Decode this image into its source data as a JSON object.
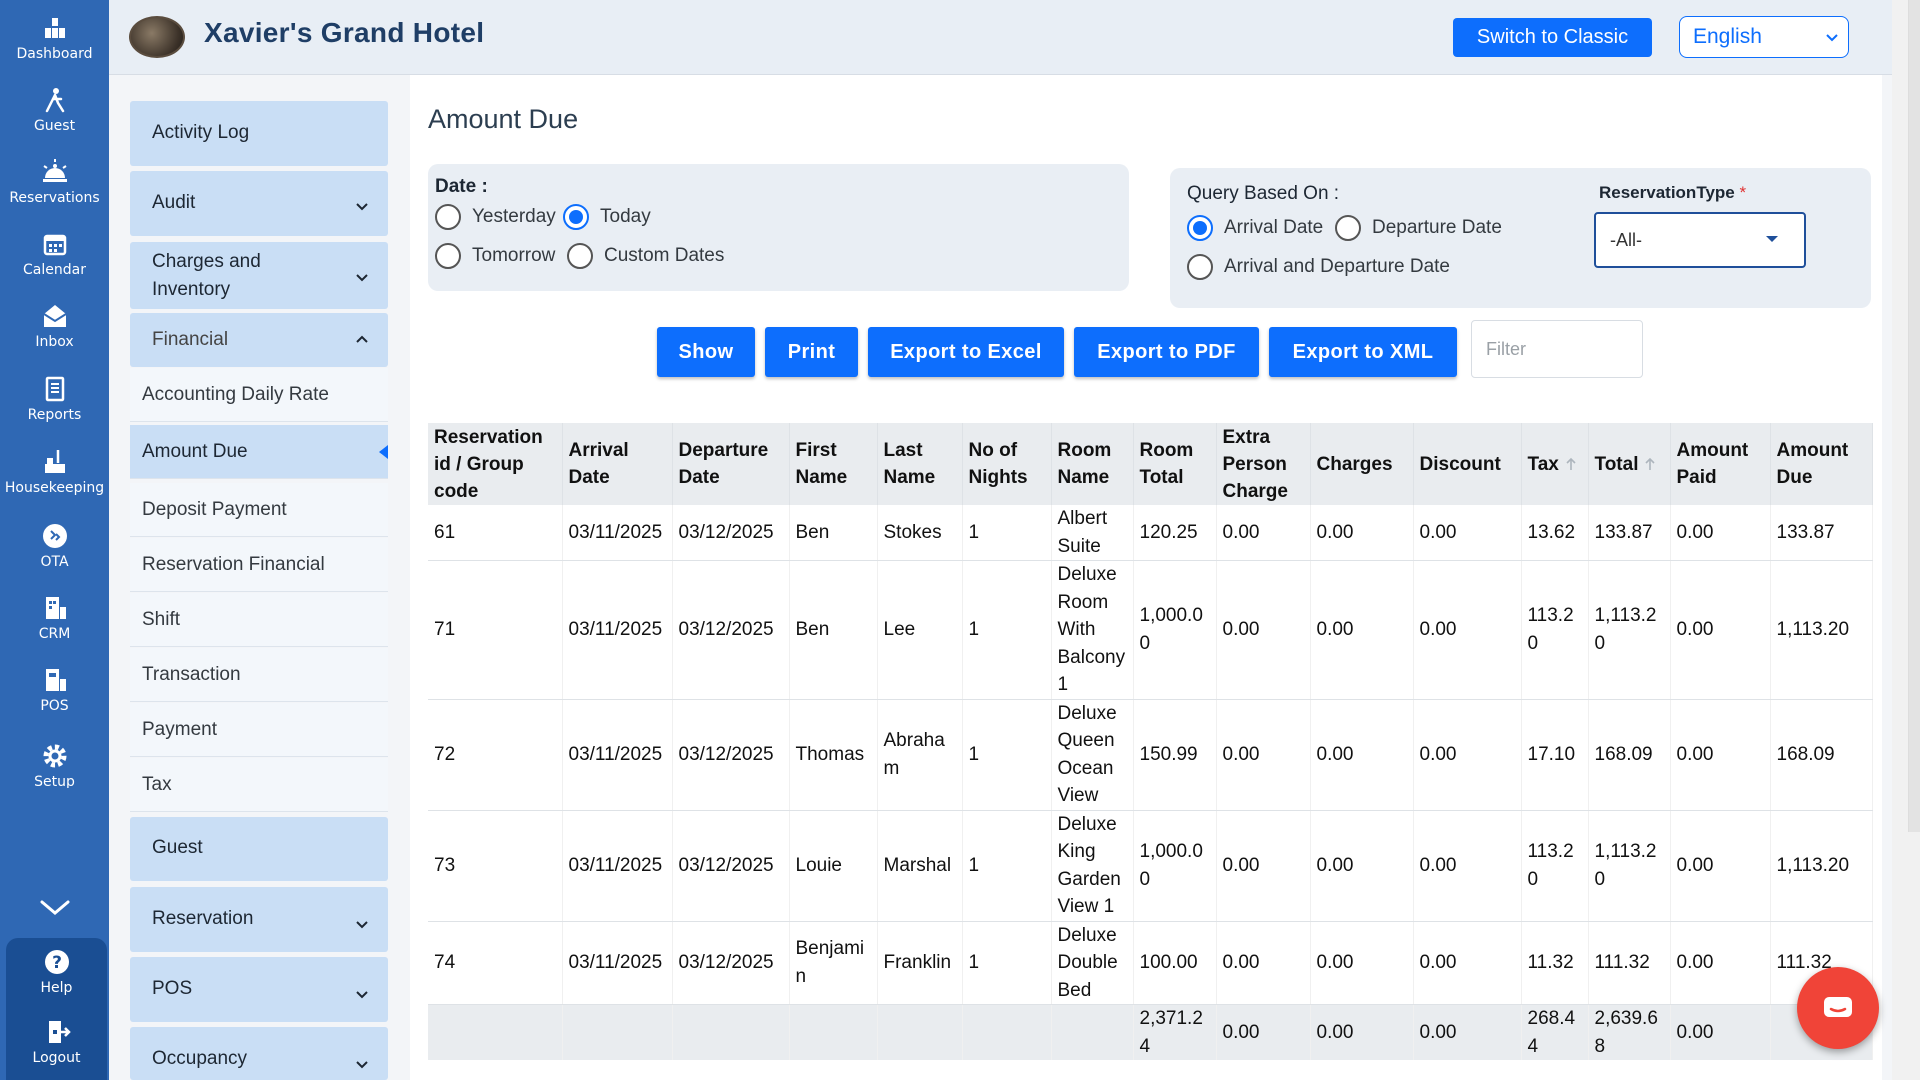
{
  "rail": {
    "items": [
      {
        "label": "Dashboard",
        "icon": "dashboard-icon"
      },
      {
        "label": "Guest",
        "icon": "guest-icon"
      },
      {
        "label": "Reservations",
        "icon": "reservations-icon"
      },
      {
        "label": "Calendar",
        "icon": "calendar-icon"
      },
      {
        "label": "Inbox",
        "icon": "inbox-icon"
      },
      {
        "label": "Reports",
        "icon": "reports-icon"
      },
      {
        "label": "Housekeeping",
        "icon": "housekeeping-icon"
      },
      {
        "label": "OTA",
        "icon": "ota-icon"
      },
      {
        "label": "CRM",
        "icon": "crm-icon"
      },
      {
        "label": "POS",
        "icon": "pos-icon"
      },
      {
        "label": "Setup",
        "icon": "setup-icon"
      }
    ],
    "help": "Help",
    "logout": "Logout"
  },
  "header": {
    "hotel_name": "Xavier's Grand Hotel",
    "switch_label": "Switch to Classic",
    "language": "English"
  },
  "sidenav": {
    "activity_log": "Activity Log",
    "audit": "Audit",
    "charges_line1": "Charges and",
    "charges_line2": "Inventory",
    "financial": "Financial",
    "financial_items": [
      "Accounting Daily Rate",
      "Amount Due",
      "Deposit Payment",
      "Reservation Financial",
      "Shift",
      "Transaction",
      "Payment",
      "Tax"
    ],
    "guest": "Guest",
    "reservation": "Reservation",
    "pos": "POS",
    "occupancy": "Occupancy"
  },
  "page": {
    "title": "Amount Due",
    "date_label": "Date :",
    "date_options": [
      "Yesterday",
      "Today",
      "Tomorrow",
      "Custom Dates"
    ],
    "date_selected": "Today",
    "query_label": "Query Based On :",
    "query_options": [
      "Arrival Date",
      "Departure Date",
      "Arrival and Departure Date"
    ],
    "query_selected": "Arrival Date",
    "restype_label": "ReservationType",
    "restype_required": "*",
    "restype_value": "-All-",
    "buttons": {
      "show": "Show",
      "print": "Print",
      "excel": "Export to Excel",
      "pdf": "Export to PDF",
      "xml": "Export to XML"
    },
    "filter_placeholder": "Filter"
  },
  "table": {
    "headers": [
      [
        "Reservation",
        "id / Group",
        "code"
      ],
      [
        "Arrival",
        "Date"
      ],
      [
        "Departure",
        "Date"
      ],
      [
        "First",
        "Name"
      ],
      [
        "Last",
        "Name"
      ],
      [
        "No of",
        "Nights"
      ],
      [
        "Room",
        "Name"
      ],
      [
        "Room",
        "Total"
      ],
      [
        "Extra",
        "Person",
        "Charge"
      ],
      [
        "Charges"
      ],
      [
        "Discount"
      ],
      [
        "Tax"
      ],
      [
        "Total"
      ],
      [
        "Amount",
        "Paid"
      ],
      [
        "Amount",
        "Due"
      ]
    ],
    "rows": [
      {
        "id": "61",
        "arrival": "03/11/2025",
        "departure": "03/12/2025",
        "first": "Ben",
        "last": "Stokes",
        "nights": "1",
        "room": [
          "Albert",
          "Suite"
        ],
        "room_total": "120.25",
        "extra": "0.00",
        "charges": "0.00",
        "discount": "0.00",
        "tax": "13.62",
        "total": "133.87",
        "paid": "0.00",
        "due": "133.87"
      },
      {
        "id": "71",
        "arrival": "03/11/2025",
        "departure": "03/12/2025",
        "first": "Ben",
        "last": "Lee",
        "nights": "1",
        "room": [
          "Deluxe",
          "Room",
          "With",
          "Balcony",
          "1"
        ],
        "room_total": "1,000.00",
        "extra": "0.00",
        "charges": "0.00",
        "discount": "0.00",
        "tax": "113.20",
        "total": "1,113.20",
        "paid": "0.00",
        "due": "1,113.20"
      },
      {
        "id": "72",
        "arrival": "03/11/2025",
        "departure": "03/12/2025",
        "first": "Thomas",
        "last": "Abraham",
        "nights": "1",
        "room": [
          "Deluxe",
          "Queen",
          "Ocean",
          "View"
        ],
        "room_total": "150.99",
        "extra": "0.00",
        "charges": "0.00",
        "discount": "0.00",
        "tax": "17.10",
        "total": "168.09",
        "paid": "0.00",
        "due": "168.09"
      },
      {
        "id": "73",
        "arrival": "03/11/2025",
        "departure": "03/12/2025",
        "first": "Louie",
        "last": "Marshal",
        "nights": "1",
        "room": [
          "Deluxe",
          "King",
          "Garden",
          "View 1"
        ],
        "room_total": "1,000.00",
        "extra": "0.00",
        "charges": "0.00",
        "discount": "0.00",
        "tax": "113.20",
        "total": "1,113.20",
        "paid": "0.00",
        "due": "1,113.20"
      },
      {
        "id": "74",
        "arrival": "03/11/2025",
        "departure": "03/12/2025",
        "first": "Benjamin",
        "last": "Franklin",
        "nights": "1",
        "room": [
          "Deluxe",
          "Double",
          "Bed"
        ],
        "room_total": "100.00",
        "extra": "0.00",
        "charges": "0.00",
        "discount": "0.00",
        "tax": "11.32",
        "total": "111.32",
        "paid": "0.00",
        "due": "111.32"
      }
    ],
    "totals": {
      "room_total": "2,371.24",
      "extra": "0.00",
      "charges": "0.00",
      "discount": "0.00",
      "tax": "268.44",
      "total": "2,639.68",
      "paid": "0.00"
    }
  },
  "colors": {
    "rail": "#2f68b4",
    "accent": "#0d6efd",
    "sidebar_group": "#c9def5",
    "chat": "#f04438"
  }
}
